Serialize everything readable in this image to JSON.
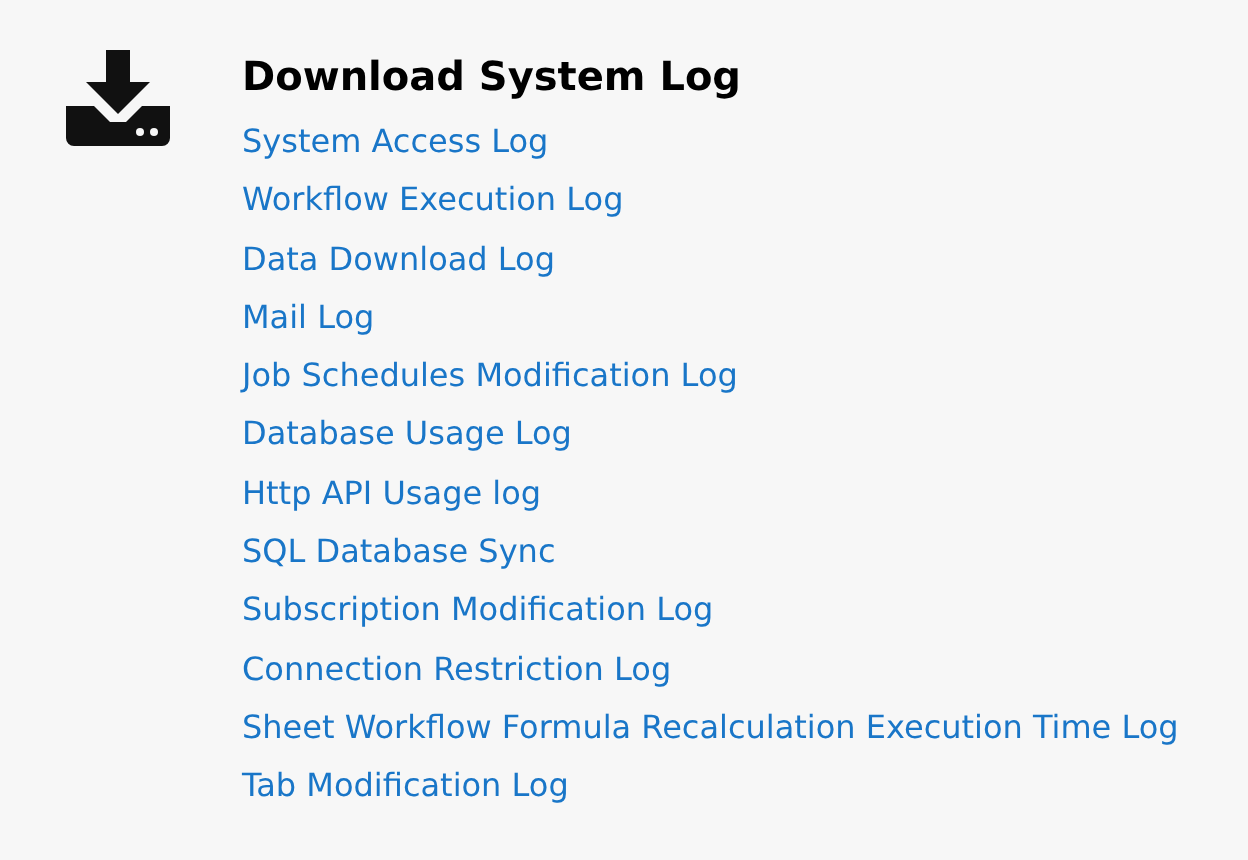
{
  "section": {
    "title": "Download System Log",
    "links": [
      {
        "label": "System Access Log"
      },
      {
        "label": "Workflow Execution Log"
      },
      {
        "label": "Data Download Log"
      },
      {
        "label": "Mail Log"
      },
      {
        "label": "Job Schedules Modification Log"
      },
      {
        "label": "Database Usage Log"
      },
      {
        "label": "Http API Usage log"
      },
      {
        "label": "SQL Database Sync"
      },
      {
        "label": "Subscription Modification Log"
      },
      {
        "label": "Connection Restriction Log"
      },
      {
        "label": "Sheet Workflow Formula Recalculation Execution Time Log"
      },
      {
        "label": "Tab Modification Log"
      }
    ]
  }
}
